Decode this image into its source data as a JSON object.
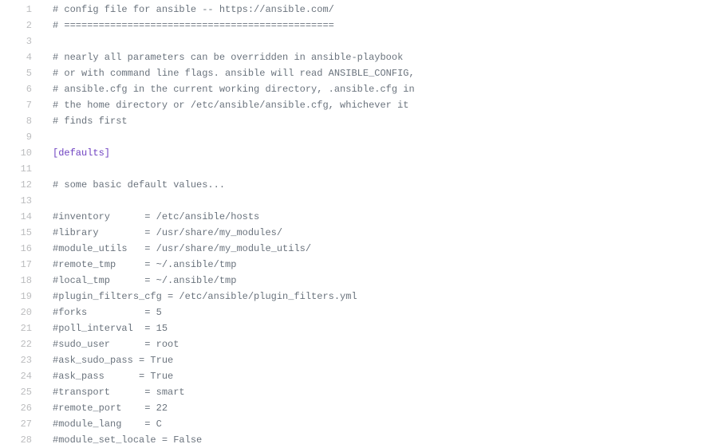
{
  "filetype": "ini/cfg",
  "description": "Ansible configuration file (ansible.cfg) shown in a code viewer with line numbers.",
  "lines": [
    {
      "n": 1,
      "tokens": [
        {
          "t": "# config file for ansible -- https://ansible.com/",
          "c": "tok-comment"
        }
      ]
    },
    {
      "n": 2,
      "tokens": [
        {
          "t": "# ===============================================",
          "c": "tok-comment"
        }
      ]
    },
    {
      "n": 3,
      "tokens": [
        {
          "t": "",
          "c": ""
        }
      ]
    },
    {
      "n": 4,
      "tokens": [
        {
          "t": "# nearly all parameters can be overridden in ansible-playbook",
          "c": "tok-comment"
        }
      ]
    },
    {
      "n": 5,
      "tokens": [
        {
          "t": "# or with command line flags. ansible will read ANSIBLE_CONFIG,",
          "c": "tok-comment"
        }
      ]
    },
    {
      "n": 6,
      "tokens": [
        {
          "t": "# ansible.cfg in the current working directory, .ansible.cfg in",
          "c": "tok-comment"
        }
      ]
    },
    {
      "n": 7,
      "tokens": [
        {
          "t": "# the home directory or /etc/ansible/ansible.cfg, whichever it",
          "c": "tok-comment"
        }
      ]
    },
    {
      "n": 8,
      "tokens": [
        {
          "t": "# finds first",
          "c": "tok-comment"
        }
      ]
    },
    {
      "n": 9,
      "tokens": [
        {
          "t": "",
          "c": ""
        }
      ]
    },
    {
      "n": 10,
      "tokens": [
        {
          "t": "[defaults]",
          "c": "tok-section"
        }
      ]
    },
    {
      "n": 11,
      "tokens": [
        {
          "t": "",
          "c": ""
        }
      ]
    },
    {
      "n": 12,
      "tokens": [
        {
          "t": "# some basic default values...",
          "c": "tok-comment"
        }
      ]
    },
    {
      "n": 13,
      "tokens": [
        {
          "t": "",
          "c": ""
        }
      ]
    },
    {
      "n": 14,
      "tokens": [
        {
          "t": "#inventory      = /etc/ansible/hosts",
          "c": "tok-comment"
        }
      ]
    },
    {
      "n": 15,
      "tokens": [
        {
          "t": "#library        = /usr/share/my_modules/",
          "c": "tok-comment"
        }
      ]
    },
    {
      "n": 16,
      "tokens": [
        {
          "t": "#module_utils   = /usr/share/my_module_utils/",
          "c": "tok-comment"
        }
      ]
    },
    {
      "n": 17,
      "tokens": [
        {
          "t": "#remote_tmp     = ~/.ansible/tmp",
          "c": "tok-comment"
        }
      ]
    },
    {
      "n": 18,
      "tokens": [
        {
          "t": "#local_tmp      = ~/.ansible/tmp",
          "c": "tok-comment"
        }
      ]
    },
    {
      "n": 19,
      "tokens": [
        {
          "t": "#plugin_filters_cfg = /etc/ansible/plugin_filters.yml",
          "c": "tok-comment"
        }
      ]
    },
    {
      "n": 20,
      "tokens": [
        {
          "t": "#forks          = 5",
          "c": "tok-comment"
        }
      ]
    },
    {
      "n": 21,
      "tokens": [
        {
          "t": "#poll_interval  = 15",
          "c": "tok-comment"
        }
      ]
    },
    {
      "n": 22,
      "tokens": [
        {
          "t": "#sudo_user      = root",
          "c": "tok-comment"
        }
      ]
    },
    {
      "n": 23,
      "tokens": [
        {
          "t": "#ask_sudo_pass = True",
          "c": "tok-comment"
        }
      ]
    },
    {
      "n": 24,
      "tokens": [
        {
          "t": "#ask_pass      = True",
          "c": "tok-comment"
        }
      ]
    },
    {
      "n": 25,
      "tokens": [
        {
          "t": "#transport      = smart",
          "c": "tok-comment"
        }
      ]
    },
    {
      "n": 26,
      "tokens": [
        {
          "t": "#remote_port    = 22",
          "c": "tok-comment"
        }
      ]
    },
    {
      "n": 27,
      "tokens": [
        {
          "t": "#module_lang    = C",
          "c": "tok-comment"
        }
      ]
    },
    {
      "n": 28,
      "tokens": [
        {
          "t": "#module_set_locale = False",
          "c": "tok-comment"
        }
      ]
    }
  ]
}
